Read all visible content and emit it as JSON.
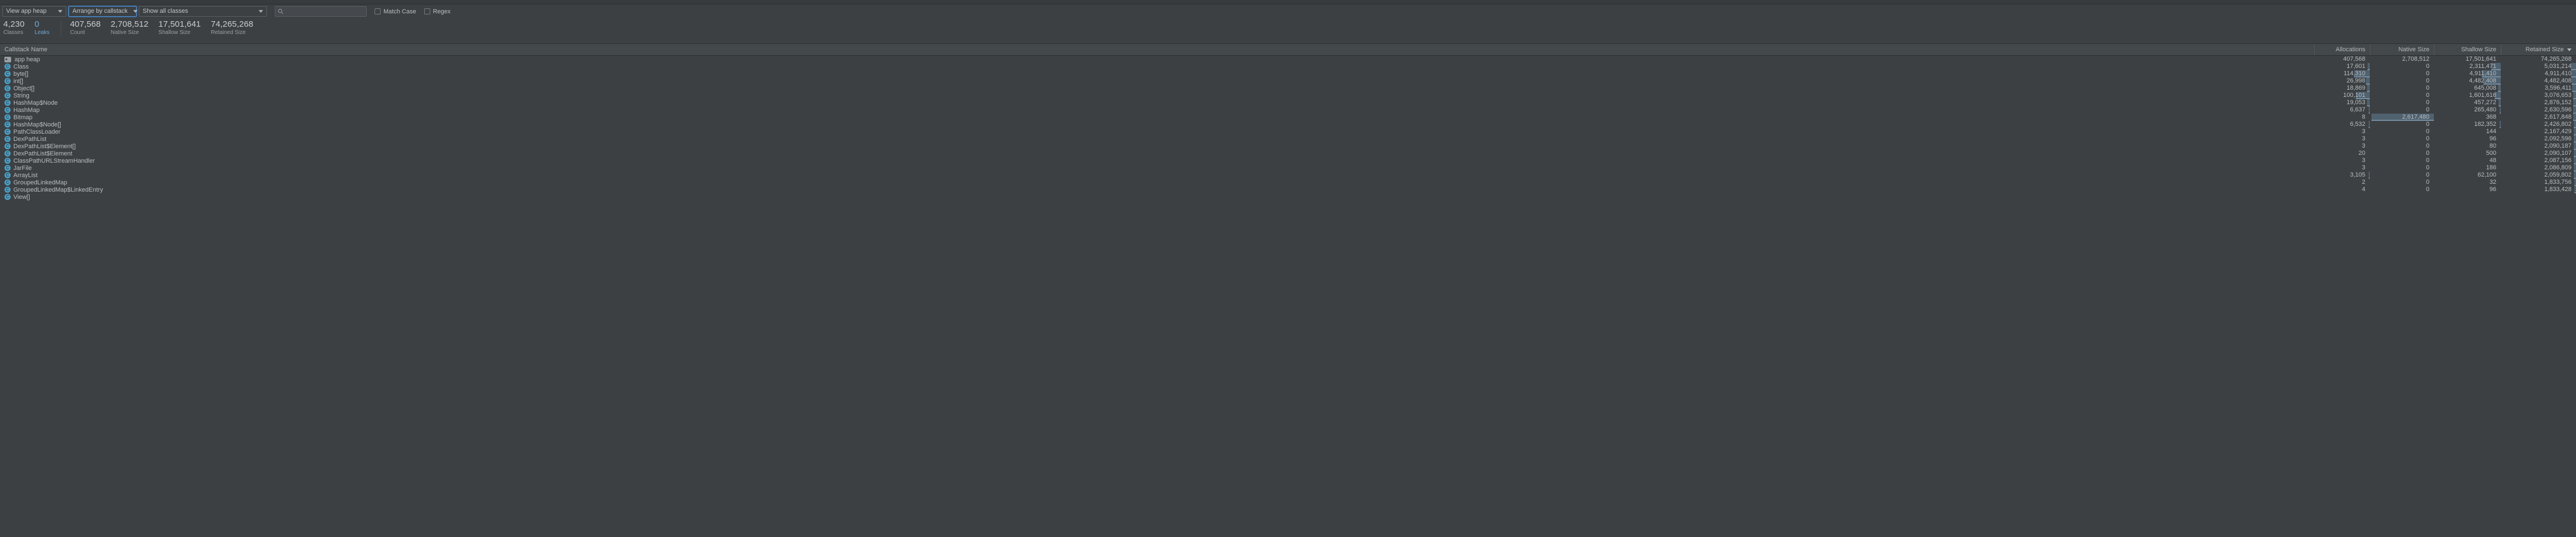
{
  "toolbar": {
    "heap_select": {
      "label": "View app heap",
      "icon": "chevron-down-icon"
    },
    "arrange_select": {
      "label": "Arrange by callstack",
      "icon": "chevron-down-icon"
    },
    "classes_select": {
      "label": "Show all classes",
      "icon": "chevron-down-icon"
    },
    "search": {
      "value": "",
      "placeholder": "",
      "icon": "search-icon"
    },
    "match_case": {
      "label": "Match Case",
      "checked": false
    },
    "regex": {
      "label": "Regex",
      "checked": false
    }
  },
  "summary": {
    "stats": [
      {
        "value": "4,230",
        "caption": "Classes",
        "accent": false
      },
      {
        "value": "0",
        "caption": "Leaks",
        "accent": true
      },
      {
        "value": "407,568",
        "caption": "Count",
        "accent": false
      },
      {
        "value": "2,708,512",
        "caption": "Native Size",
        "accent": false
      },
      {
        "value": "17,501,641",
        "caption": "Shallow Size",
        "accent": false
      },
      {
        "value": "74,265,268",
        "caption": "Retained Size",
        "accent": false
      }
    ]
  },
  "colors": {
    "background": "#3c4043",
    "header_background": "#43484b",
    "accent_blue": "#6fa8d8",
    "bar_fill": "#78a0c4",
    "class_icon": "#4a9ec4",
    "focus_border": "#4a88c7"
  },
  "table": {
    "columns": [
      {
        "key": "name",
        "label": "Callstack Name",
        "align": "left",
        "sorted": false
      },
      {
        "key": "allocations",
        "label": "Allocations",
        "align": "right",
        "sorted": false
      },
      {
        "key": "native",
        "label": "Native Size",
        "align": "right",
        "sorted": false
      },
      {
        "key": "shallow",
        "label": "Shallow Size",
        "align": "right",
        "sorted": false
      },
      {
        "key": "retained",
        "label": "Retained Size",
        "align": "right",
        "sorted": true,
        "sort_icon": "sort-desc-icon"
      }
    ],
    "rows": [
      {
        "name": "app heap",
        "icon": "folder-icon",
        "depth": 0,
        "allocations": "407,568",
        "native": "2,708,512",
        "shallow": "17,501,641",
        "retained": "74,265,268",
        "bars": {
          "allocations": 0,
          "native": 0,
          "shallow": 0,
          "retained": 0
        }
      },
      {
        "name": "Class",
        "icon": "class-icon",
        "depth": 1,
        "allocations": "17,601",
        "native": "0",
        "shallow": "2,311,471",
        "retained": "5,031,214",
        "bars": {
          "allocations": 4,
          "native": 0,
          "shallow": 14,
          "retained": 7
        }
      },
      {
        "name": "byte[]",
        "icon": "class-icon",
        "depth": 1,
        "allocations": "114,310",
        "native": "0",
        "shallow": "4,911,410",
        "retained": "4,911,410",
        "bars": {
          "allocations": 28,
          "native": 0,
          "shallow": 28,
          "retained": 7
        }
      },
      {
        "name": "int[]",
        "icon": "class-icon",
        "depth": 1,
        "allocations": "26,998",
        "native": "0",
        "shallow": "4,482,408",
        "retained": "4,482,408",
        "bars": {
          "allocations": 7,
          "native": 0,
          "shallow": 26,
          "retained": 6
        }
      },
      {
        "name": "Object[]",
        "icon": "class-icon",
        "depth": 1,
        "allocations": "18,869",
        "native": "0",
        "shallow": "645,008",
        "retained": "3,596,411",
        "bars": {
          "allocations": 5,
          "native": 0,
          "shallow": 4,
          "retained": 5
        }
      },
      {
        "name": "String",
        "icon": "class-icon",
        "depth": 1,
        "allocations": "100,101",
        "native": "0",
        "shallow": "1,601,616",
        "retained": "3,076,653",
        "bars": {
          "allocations": 25,
          "native": 0,
          "shallow": 9,
          "retained": 4
        }
      },
      {
        "name": "HashMap$Node",
        "icon": "class-icon",
        "depth": 1,
        "allocations": "19,053",
        "native": "0",
        "shallow": "457,272",
        "retained": "2,876,152",
        "bars": {
          "allocations": 5,
          "native": 0,
          "shallow": 3,
          "retained": 4
        }
      },
      {
        "name": "HashMap",
        "icon": "class-icon",
        "depth": 1,
        "allocations": "6,637",
        "native": "0",
        "shallow": "265,480",
        "retained": "2,630,596",
        "bars": {
          "allocations": 2,
          "native": 0,
          "shallow": 2,
          "retained": 4
        }
      },
      {
        "name": "Bitmap",
        "icon": "class-icon",
        "depth": 1,
        "allocations": "8",
        "native": "2,617,480",
        "shallow": "368",
        "retained": "2,617,848",
        "bars": {
          "allocations": 0,
          "native": 97,
          "shallow": 0,
          "retained": 4
        }
      },
      {
        "name": "HashMap$Node[]",
        "icon": "class-icon",
        "depth": 1,
        "allocations": "6,532",
        "native": "0",
        "shallow": "182,352",
        "retained": "2,426,802",
        "bars": {
          "allocations": 2,
          "native": 0,
          "shallow": 1,
          "retained": 3
        }
      },
      {
        "name": "PathClassLoader",
        "icon": "class-icon",
        "depth": 1,
        "allocations": "3",
        "native": "0",
        "shallow": "144",
        "retained": "2,167,429",
        "bars": {
          "allocations": 0,
          "native": 0,
          "shallow": 0,
          "retained": 3
        }
      },
      {
        "name": "DexPathList",
        "icon": "class-icon",
        "depth": 1,
        "allocations": "3",
        "native": "0",
        "shallow": "96",
        "retained": "2,092,596",
        "bars": {
          "allocations": 0,
          "native": 0,
          "shallow": 0,
          "retained": 3
        }
      },
      {
        "name": "DexPathList$Element[]",
        "icon": "class-icon",
        "depth": 1,
        "allocations": "3",
        "native": "0",
        "shallow": "80",
        "retained": "2,090,187",
        "bars": {
          "allocations": 0,
          "native": 0,
          "shallow": 0,
          "retained": 3
        }
      },
      {
        "name": "DexPathList$Element",
        "icon": "class-icon",
        "depth": 1,
        "allocations": "20",
        "native": "0",
        "shallow": "500",
        "retained": "2,090,107",
        "bars": {
          "allocations": 0,
          "native": 0,
          "shallow": 0,
          "retained": 3
        }
      },
      {
        "name": "ClassPathURLStreamHandler",
        "icon": "class-icon",
        "depth": 1,
        "allocations": "3",
        "native": "0",
        "shallow": "48",
        "retained": "2,087,156",
        "bars": {
          "allocations": 0,
          "native": 0,
          "shallow": 0,
          "retained": 3
        }
      },
      {
        "name": "JarFile",
        "icon": "class-icon",
        "depth": 1,
        "allocations": "3",
        "native": "0",
        "shallow": "186",
        "retained": "2,086,809",
        "bars": {
          "allocations": 0,
          "native": 0,
          "shallow": 0,
          "retained": 3
        }
      },
      {
        "name": "ArrayList",
        "icon": "class-icon",
        "depth": 1,
        "allocations": "3,105",
        "native": "0",
        "shallow": "62,100",
        "retained": "2,059,802",
        "bars": {
          "allocations": 1,
          "native": 0,
          "shallow": 0,
          "retained": 3
        }
      },
      {
        "name": "GroupedLinkedMap",
        "icon": "class-icon",
        "depth": 1,
        "allocations": "2",
        "native": "0",
        "shallow": "32",
        "retained": "1,833,756",
        "bars": {
          "allocations": 0,
          "native": 0,
          "shallow": 0,
          "retained": 2
        }
      },
      {
        "name": "GroupedLinkedMap$LinkedEntry",
        "icon": "class-icon",
        "depth": 1,
        "allocations": "4",
        "native": "0",
        "shallow": "96",
        "retained": "1,833,428",
        "bars": {
          "allocations": 0,
          "native": 0,
          "shallow": 0,
          "retained": 2
        }
      },
      {
        "name": "View[]",
        "icon": "class-icon",
        "depth": 1,
        "allocations": "",
        "native": "",
        "shallow": "",
        "retained": "",
        "bars": {
          "allocations": 0,
          "native": 0,
          "shallow": 0,
          "retained": 0
        }
      }
    ]
  }
}
